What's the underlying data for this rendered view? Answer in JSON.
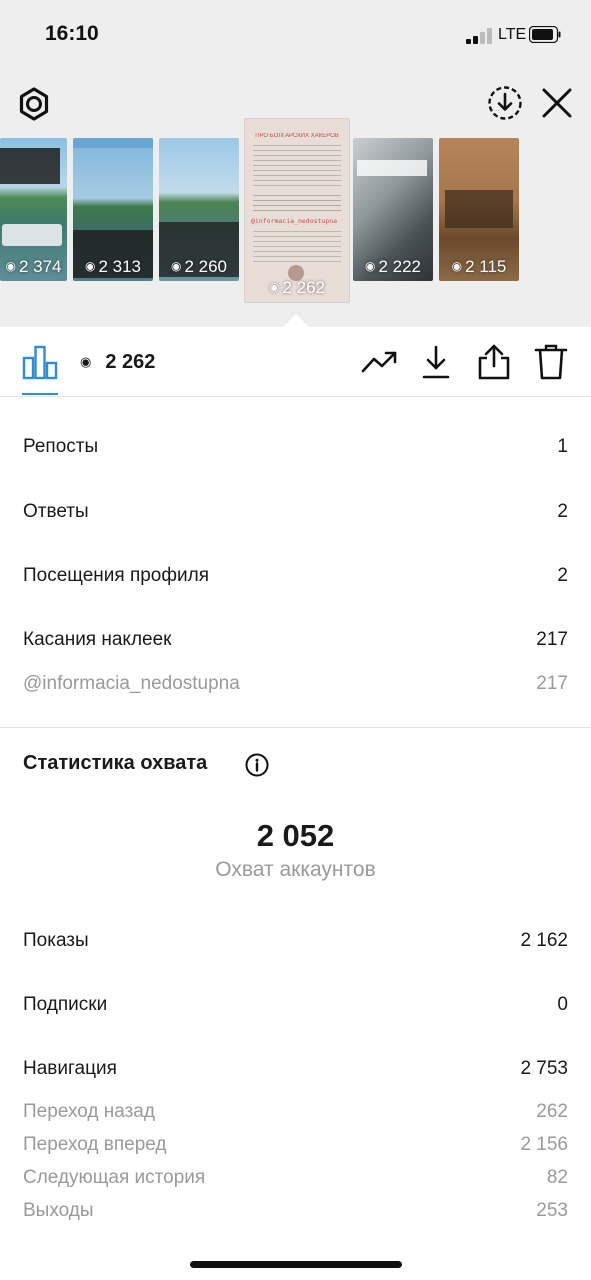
{
  "status_bar": {
    "time": "16:10",
    "network": "LTE"
  },
  "stories": [
    {
      "views": "2 374"
    },
    {
      "views": "2 313"
    },
    {
      "views": "2 260"
    },
    {
      "views": "2 262",
      "title": "ПРО БОЛГАРСКИХ ХАКЕРОВ",
      "mention": "@informacia_nedostupna"
    },
    {
      "views": "2 222"
    },
    {
      "views": "2 115"
    }
  ],
  "toolbar": {
    "views": "2 262"
  },
  "interactions": [
    {
      "label": "Репосты",
      "value": "1"
    },
    {
      "label": "Ответы",
      "value": "2"
    },
    {
      "label": "Посещения профиля",
      "value": "2"
    },
    {
      "label": "Касания наклеек",
      "value": "217"
    }
  ],
  "sticker_sub": {
    "label": "@informacia_nedostupna",
    "value": "217"
  },
  "reach": {
    "title": "Статистика охвата",
    "value": "2 052",
    "label": "Охват аккаунтов",
    "rows": [
      {
        "label": "Показы",
        "value": "2 162"
      },
      {
        "label": "Подписки",
        "value": "0"
      },
      {
        "label": "Навигация",
        "value": "2 753"
      }
    ],
    "navigation": [
      {
        "label": "Переход назад",
        "value": "262"
      },
      {
        "label": "Переход вперед",
        "value": "2 156"
      },
      {
        "label": "Следующая история",
        "value": "82"
      },
      {
        "label": "Выходы",
        "value": "253"
      }
    ]
  },
  "colors": {
    "accent": "#2d8ed6",
    "muted": "#9a9a9a"
  }
}
